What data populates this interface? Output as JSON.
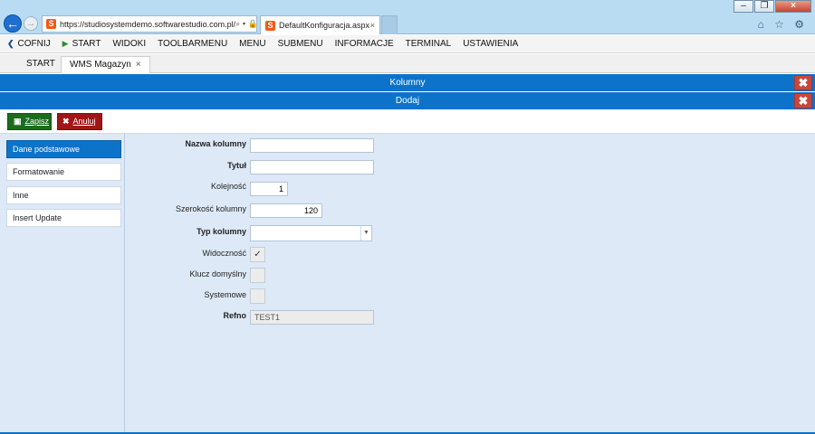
{
  "browser": {
    "url": "https://studiosystemdemo.softwarestudio.com.pl/",
    "address_icons": "⌕ ▾ 🔒 C",
    "tab_title": "DefaultKonfiguracja.aspx",
    "tab_close": "×",
    "site_logo_letter": "S",
    "tools": "⌂ ☆ ⚙",
    "window_buttons": {
      "minimize": "–",
      "restore": "❐",
      "close": "×"
    },
    "back_glyph": "←",
    "forward_glyph": "→"
  },
  "menu": {
    "items": [
      {
        "label": "COFNIJ",
        "icon": "chevron-left-icon",
        "glyph": "❮"
      },
      {
        "label": "START",
        "icon": "play-icon",
        "glyph": "▶"
      },
      {
        "label": "WIDOKI"
      },
      {
        "label": "TOOLBARMENU"
      },
      {
        "label": "MENU"
      },
      {
        "label": "SUBMENU"
      },
      {
        "label": "INFORMACJE"
      },
      {
        "label": "TERMINAL"
      },
      {
        "label": "USTAWIENIA"
      }
    ]
  },
  "app_tabs": {
    "start": "START",
    "wms": "WMS Magazyn",
    "wms_close": "×"
  },
  "titlebars": {
    "kolumny": "Kolumny",
    "dodaj": "Dodaj",
    "close_glyph": "✖"
  },
  "toolbar": {
    "save_label": "Zapisz",
    "save_icon": "save-icon",
    "save_glyph": "▣",
    "cancel_label": "Anuluj",
    "cancel_icon": "close-icon",
    "cancel_glyph": "✖"
  },
  "sidebar": {
    "items": [
      {
        "label": "Dane podstawowe",
        "active": true
      },
      {
        "label": "Formatowanie",
        "active": false
      },
      {
        "label": "Inne",
        "active": false
      },
      {
        "label": "Insert Update",
        "active": false
      }
    ]
  },
  "form": {
    "nazwa_kolumny": {
      "label": "Nazwa kolumny",
      "value": ""
    },
    "tytul": {
      "label": "Tytuł",
      "value": ""
    },
    "kolejnosc": {
      "label": "Kolejność",
      "value": "1"
    },
    "szerokosc": {
      "label": "Szerokość kolumny",
      "value": "120"
    },
    "typ_kolumny": {
      "label": "Typ kolumny",
      "value": "",
      "arrow": "▼"
    },
    "widocznosc": {
      "label": "Widoczność",
      "checked": true,
      "glyph": "✓"
    },
    "klucz_domyslny": {
      "label": "Klucz domyślny",
      "checked": false
    },
    "systemowe": {
      "label": "Systemowe",
      "checked": false
    },
    "refno": {
      "label": "Refno",
      "value": "TEST1"
    }
  },
  "colors": {
    "accent": "#0d73c8",
    "save": "#1d6b1d",
    "cancel": "#a01616",
    "panel": "#dde9f7"
  }
}
